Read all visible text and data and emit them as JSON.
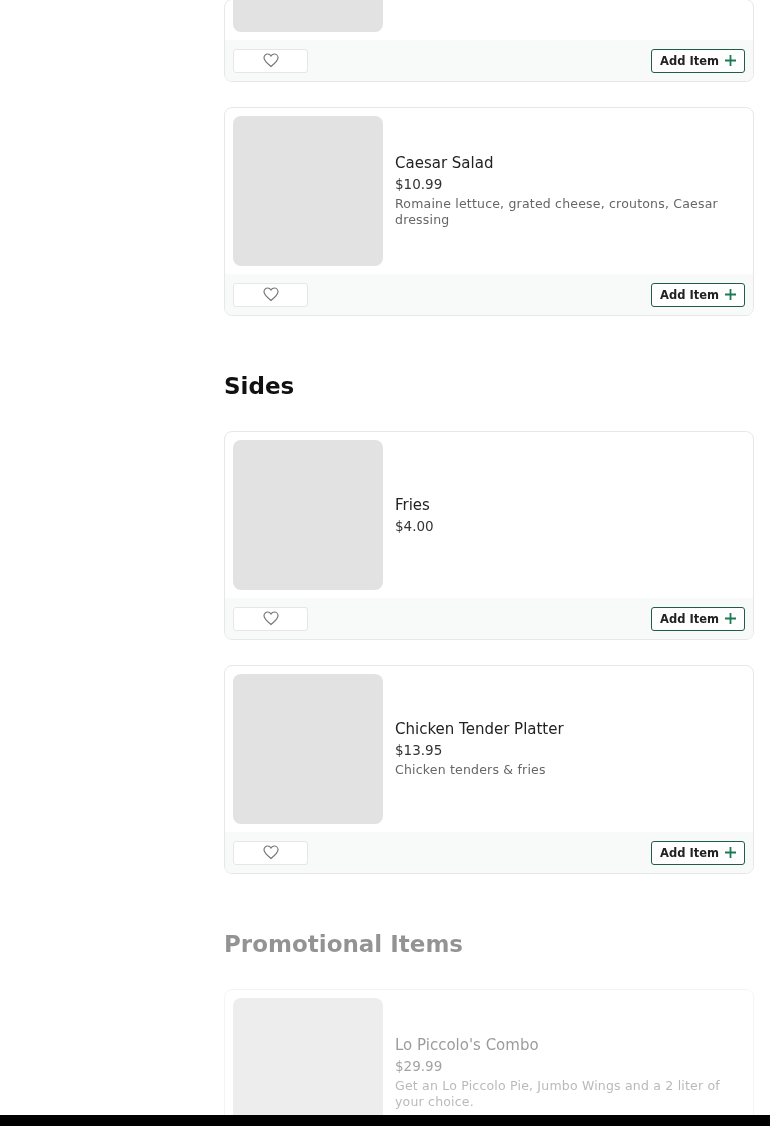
{
  "sections": [
    {
      "items": [
        {
          "kind": "cut",
          "favorite": false,
          "button": "Add Item"
        },
        {
          "kind": "full",
          "name": "Caesar Salad",
          "price": "$10.99",
          "description": "Romaine lettuce, grated cheese, croutons, Caesar dressing",
          "favorite": false,
          "button": "Add Item"
        }
      ]
    },
    {
      "title": "Sides",
      "disabled": false,
      "items": [
        {
          "kind": "full",
          "name": "Fries",
          "price": "$4.00",
          "favorite": false,
          "button": "Add Item"
        },
        {
          "kind": "full",
          "name": "Chicken Tender Platter",
          "price": "$13.95",
          "description": "Chicken tenders & fries",
          "favorite": false,
          "button": "Add Item"
        }
      ]
    },
    {
      "title": "Promotional Items",
      "disabled": true,
      "items": [
        {
          "kind": "full",
          "name": "Lo Piccolo's Combo",
          "price": "$29.99",
          "description": "Get an Lo Piccolo Pie, Jumbo Wings and a 2 liter of your choice."
        }
      ]
    }
  ]
}
